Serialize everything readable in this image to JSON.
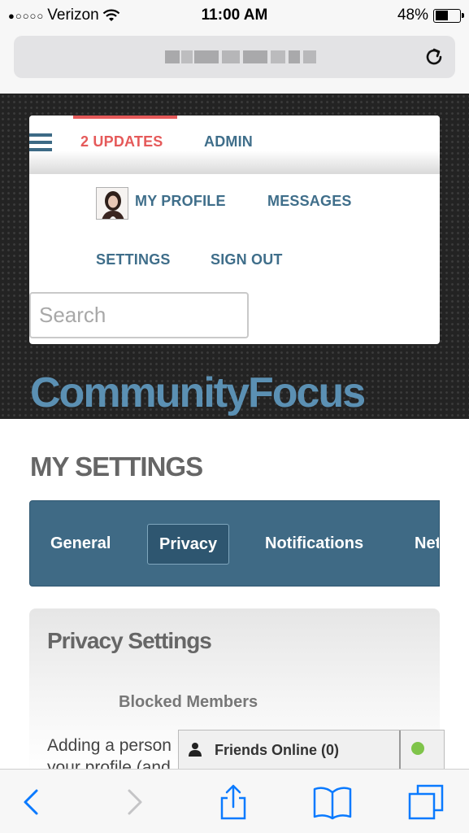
{
  "status_bar": {
    "signal_dots": "●○○○○",
    "carrier": "Verizon",
    "time": "11:00 AM",
    "battery_percent": "48%",
    "battery_level": 0.48
  },
  "browser": {
    "url": "",
    "reload_icon": "reload-icon"
  },
  "nav": {
    "updates": "2 UPDATES",
    "admin": "ADMIN",
    "my_profile": "MY PROFILE",
    "messages": "MESSAGES",
    "settings": "SETTINGS",
    "sign_out": "SIGN OUT",
    "search_placeholder": "Search",
    "accent_color": "#e55a5a",
    "link_color": "#3f6e8a"
  },
  "site": {
    "logo": "CommunityFocus"
  },
  "page": {
    "title": "MY SETTINGS",
    "tabs": [
      {
        "label": "General"
      },
      {
        "label": "Privacy",
        "active": true
      },
      {
        "label": "Notifications"
      },
      {
        "label": "Net"
      }
    ],
    "panel": {
      "title": "Privacy Settings",
      "subheading": "Blocked Members",
      "body_line1": "Adding a person",
      "body_line2": "your profile (and"
    }
  },
  "friends_widget": {
    "label": "Friends Online (0)",
    "status_color": "#7fc44a"
  },
  "toolbar": {
    "icons": [
      "back-icon",
      "forward-icon",
      "share-icon",
      "bookmarks-icon",
      "tabs-icon"
    ]
  }
}
